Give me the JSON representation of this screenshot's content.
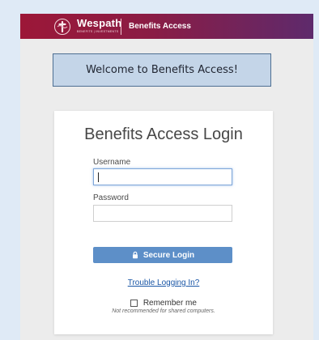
{
  "header": {
    "brand": "Wespath",
    "brand_sub": "BENEFITS | INVESTMENTS",
    "title": "Benefits Access",
    "colors": {
      "start": "#9c1738",
      "end": "#5e2a6c"
    }
  },
  "welcome": {
    "text": "Welcome to Benefits Access!"
  },
  "login": {
    "title": "Benefits Access Login",
    "username_label": "Username",
    "username_value": "",
    "password_label": "Password",
    "password_value": "",
    "button_label": "Secure Login",
    "button_icon": "lock-icon",
    "trouble_link": "Trouble Logging In?",
    "remember_label": "Remember me",
    "remember_checked": false,
    "remember_note": "Not recommended for shared computers."
  }
}
